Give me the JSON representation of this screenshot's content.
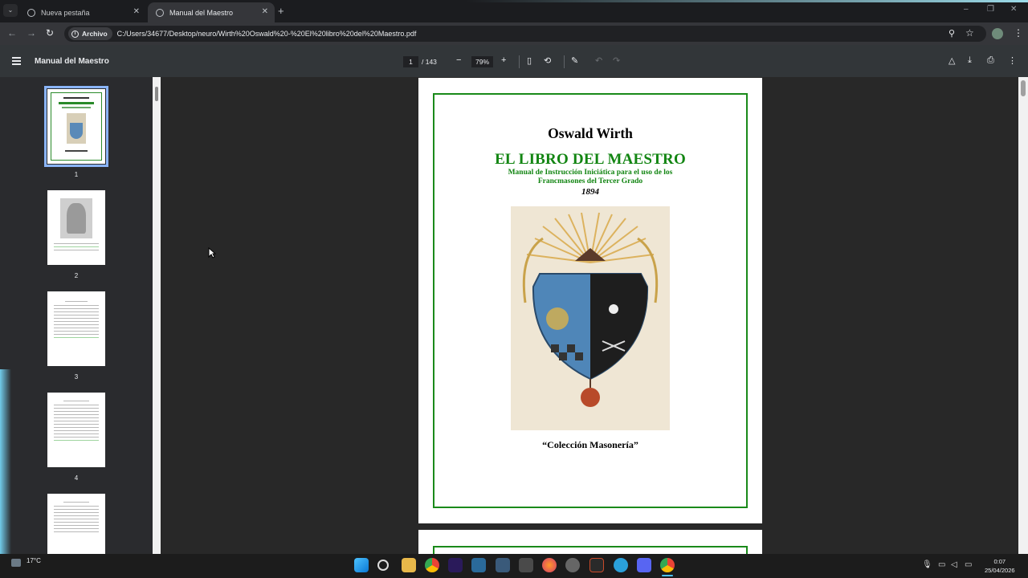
{
  "browser": {
    "tabs": [
      {
        "label": "Nueva pestaña",
        "active": false
      },
      {
        "label": "Manual del Maestro",
        "active": true
      }
    ],
    "security_chip": "Archivo",
    "url": "C:/Users/34677/Desktop/neuro/Wirth%20Oswald%20-%20El%20libro%20del%20Maestro.pdf"
  },
  "pdf_toolbar": {
    "title": "Manual del Maestro",
    "current_page": "1",
    "total_pages": "/ 143",
    "zoom": "79%"
  },
  "thumbnails": [
    {
      "number": "1",
      "selected": true
    },
    {
      "number": "2",
      "selected": false
    },
    {
      "number": "3",
      "selected": false
    },
    {
      "number": "4",
      "selected": false
    },
    {
      "number": "",
      "selected": false
    }
  ],
  "page": {
    "author": "Oswald Wirth",
    "title": "EL LIBRO DEL MAESTRO",
    "subtitle_line1": "Manual de Instrucción Iniciática para el uso de los",
    "subtitle_line2": "Francmasones del Tercer Grado",
    "year": "1894",
    "collection": "“Colección Masonería”"
  },
  "taskbar": {
    "weather": "17°C",
    "time": "0:07",
    "date": "25/04/2026"
  },
  "colors": {
    "accent": "#8ab4f8",
    "page_green": "#128512"
  }
}
